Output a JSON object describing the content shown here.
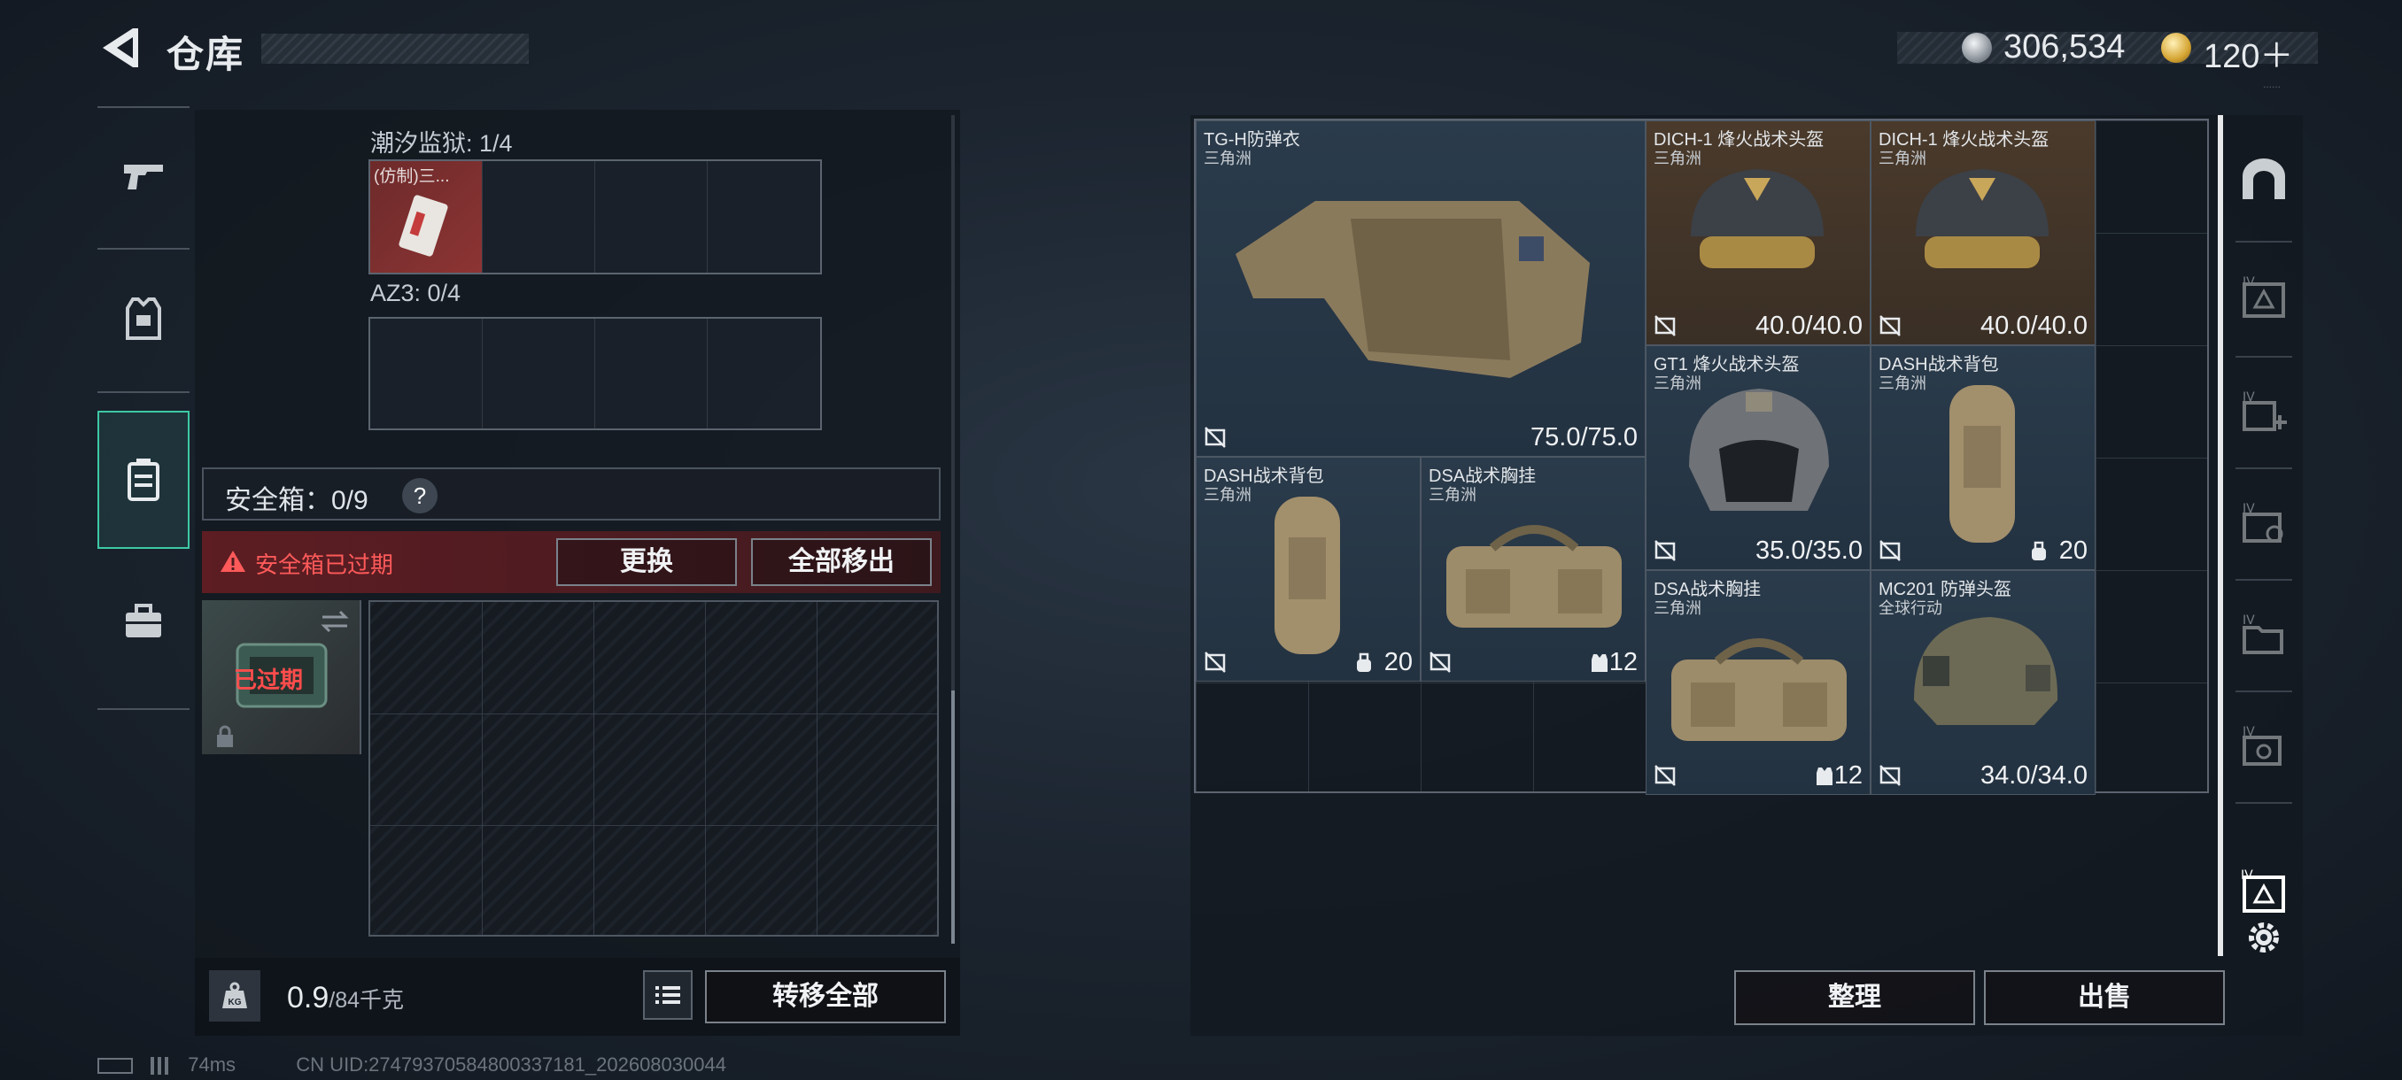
{
  "header": {
    "title": "仓库",
    "currency_silver": "306,534",
    "currency_gold": "120＋",
    "version": "......"
  },
  "left_nav": [
    "gun-icon",
    "armor-vest-icon",
    "safe-case-icon",
    "toolbox-icon"
  ],
  "left": {
    "prison_label": "潮汐监狱: 1/4",
    "fake_item": "(仿制)三...",
    "az3_label": "AZ3: 0/4",
    "safe_label": "安全箱：0/9",
    "help": "?",
    "expired_notice": "安全箱已过期",
    "replace_btn": "更换",
    "move_all_btn": "全部移出",
    "case_expired": "已过期",
    "weight_current": "0.9",
    "weight_max": "/84千克",
    "kg_icon": "KG",
    "transfer_all_btn": "转移全部"
  },
  "status": {
    "ping": "74ms",
    "uid": "CN UID:2747937058480033718​1_202608030044"
  },
  "stash": {
    "items": [
      {
        "name": "TG-H防弹衣",
        "origin": "三角洲",
        "value": "75.0/75.0"
      },
      {
        "name": "DICH-1 烽火战术头盔",
        "origin": "三角洲",
        "value": "40.0/40.0"
      },
      {
        "name": "DICH-1 烽火战术头盔",
        "origin": "三角洲",
        "value": "40.0/40.0"
      },
      {
        "name": "GT1 烽火战术头盔",
        "origin": "三角洲",
        "value": "35.0/35.0"
      },
      {
        "name": "DASH战术背包",
        "origin": "三角洲",
        "value": "20"
      },
      {
        "name": "DASH战术背包",
        "origin": "三角洲",
        "value": "20"
      },
      {
        "name": "DSA战术胸挂",
        "origin": "三角洲",
        "value": "12"
      },
      {
        "name": "DSA战术胸挂",
        "origin": "三角洲",
        "value": "12"
      },
      {
        "name": "MC201 防弹头盔",
        "origin": "全球行动",
        "value": "34.0/34.0"
      }
    ]
  },
  "right_actions": {
    "sort_btn": "整理",
    "sell_btn": "出售"
  },
  "right_rail": [
    "vault-door-icon",
    "case-tier4-icon",
    "case-tier4-add-icon",
    "case-tier4-lock-icon",
    "case-tier4-folder-icon",
    "case-tier4-search-icon",
    "case-select-icon",
    "settings-icon"
  ],
  "colors": {
    "accent": "#3ec9a4",
    "danger": "#ff5a5a",
    "gold_rarity": "#4a3a2b",
    "blue_rarity": "#2a3b4b"
  }
}
